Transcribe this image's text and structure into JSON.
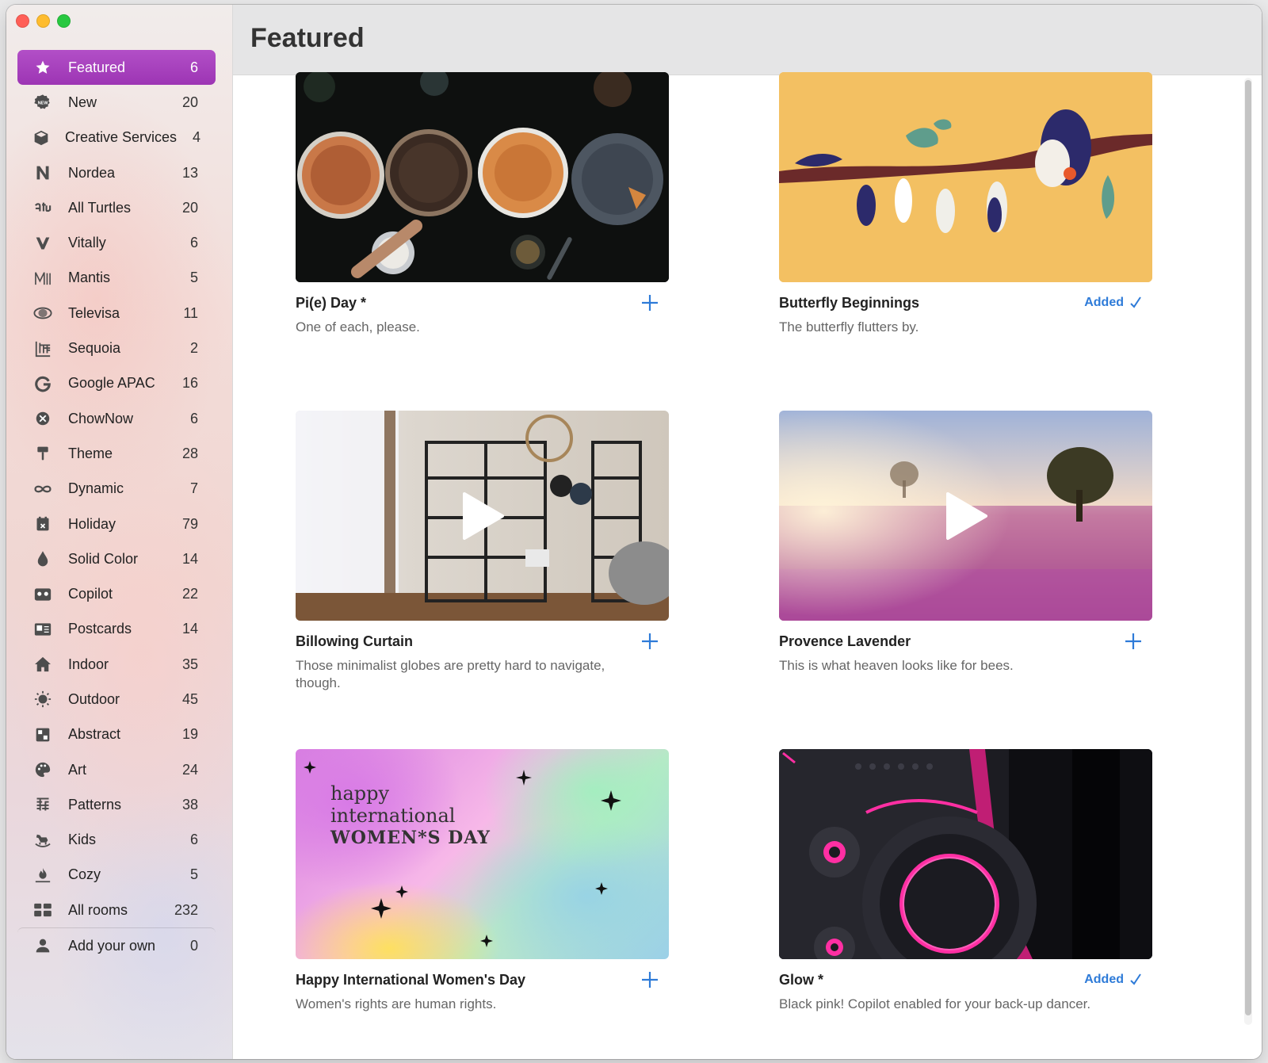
{
  "window": {
    "title": "Featured"
  },
  "sidebar": {
    "items": [
      {
        "label": "Featured",
        "count": "6",
        "icon": "star-icon",
        "active": true
      },
      {
        "label": "New",
        "count": "20",
        "icon": "new-badge-icon"
      },
      {
        "label": "Creative Services",
        "count": "4",
        "icon": "cube-icon"
      },
      {
        "label": "Nordea",
        "count": "13",
        "icon": "nordea-n-icon"
      },
      {
        "label": "All Turtles",
        "count": "20",
        "icon": "all-turtles-icon"
      },
      {
        "label": "Vitally",
        "count": "6",
        "icon": "vitally-v-icon"
      },
      {
        "label": "Mantis",
        "count": "5",
        "icon": "mantis-m-icon"
      },
      {
        "label": "Televisa",
        "count": "11",
        "icon": "televisa-eye-icon"
      },
      {
        "label": "Sequoia",
        "count": "2",
        "icon": "sequoia-icon"
      },
      {
        "label": "Google APAC",
        "count": "16",
        "icon": "google-g-icon"
      },
      {
        "label": "ChowNow",
        "count": "6",
        "icon": "chownow-icon"
      },
      {
        "label": "Theme",
        "count": "28",
        "icon": "paint-roller-icon"
      },
      {
        "label": "Dynamic",
        "count": "7",
        "icon": "infinity-icon"
      },
      {
        "label": "Holiday",
        "count": "79",
        "icon": "calendar-icon"
      },
      {
        "label": "Solid Color",
        "count": "14",
        "icon": "drop-icon"
      },
      {
        "label": "Copilot",
        "count": "22",
        "icon": "copilot-icon"
      },
      {
        "label": "Postcards",
        "count": "14",
        "icon": "postcard-icon"
      },
      {
        "label": "Indoor",
        "count": "35",
        "icon": "house-icon"
      },
      {
        "label": "Outdoor",
        "count": "45",
        "icon": "sun-icon"
      },
      {
        "label": "Abstract",
        "count": "19",
        "icon": "abstract-icon"
      },
      {
        "label": "Art",
        "count": "24",
        "icon": "palette-icon"
      },
      {
        "label": "Patterns",
        "count": "38",
        "icon": "patterns-icon"
      },
      {
        "label": "Kids",
        "count": "6",
        "icon": "rocking-horse-icon"
      },
      {
        "label": "Cozy",
        "count": "5",
        "icon": "fireplace-icon"
      },
      {
        "label": "All rooms",
        "count": "232",
        "icon": "grid-icon"
      },
      {
        "label": "Add your own",
        "count": "0",
        "icon": "person-icon"
      }
    ]
  },
  "cards": [
    {
      "title": "Pi(e) Day *",
      "desc": "One of each, please.",
      "status": "add"
    },
    {
      "title": "Butterfly Beginnings",
      "desc": "The butterfly flutters by.",
      "status": "added",
      "added_label": "Added"
    },
    {
      "title": "Billowing Curtain",
      "desc": "Those minimalist globes are pretty hard to navigate, though.",
      "status": "add"
    },
    {
      "title": "Provence Lavender",
      "desc": "This is what heaven looks like for bees.",
      "status": "add"
    },
    {
      "title": "Happy International Women's Day",
      "desc": "Women's rights are human rights.",
      "status": "add",
      "art_text": [
        "happy",
        "international",
        "WOMEN*S DAY"
      ]
    },
    {
      "title": "Glow *",
      "desc": "Black pink! Copilot enabled for your back-up dancer.",
      "status": "added",
      "added_label": "Added"
    }
  ],
  "colors": {
    "accent": "#a33fba",
    "link": "#2e7bd8"
  }
}
